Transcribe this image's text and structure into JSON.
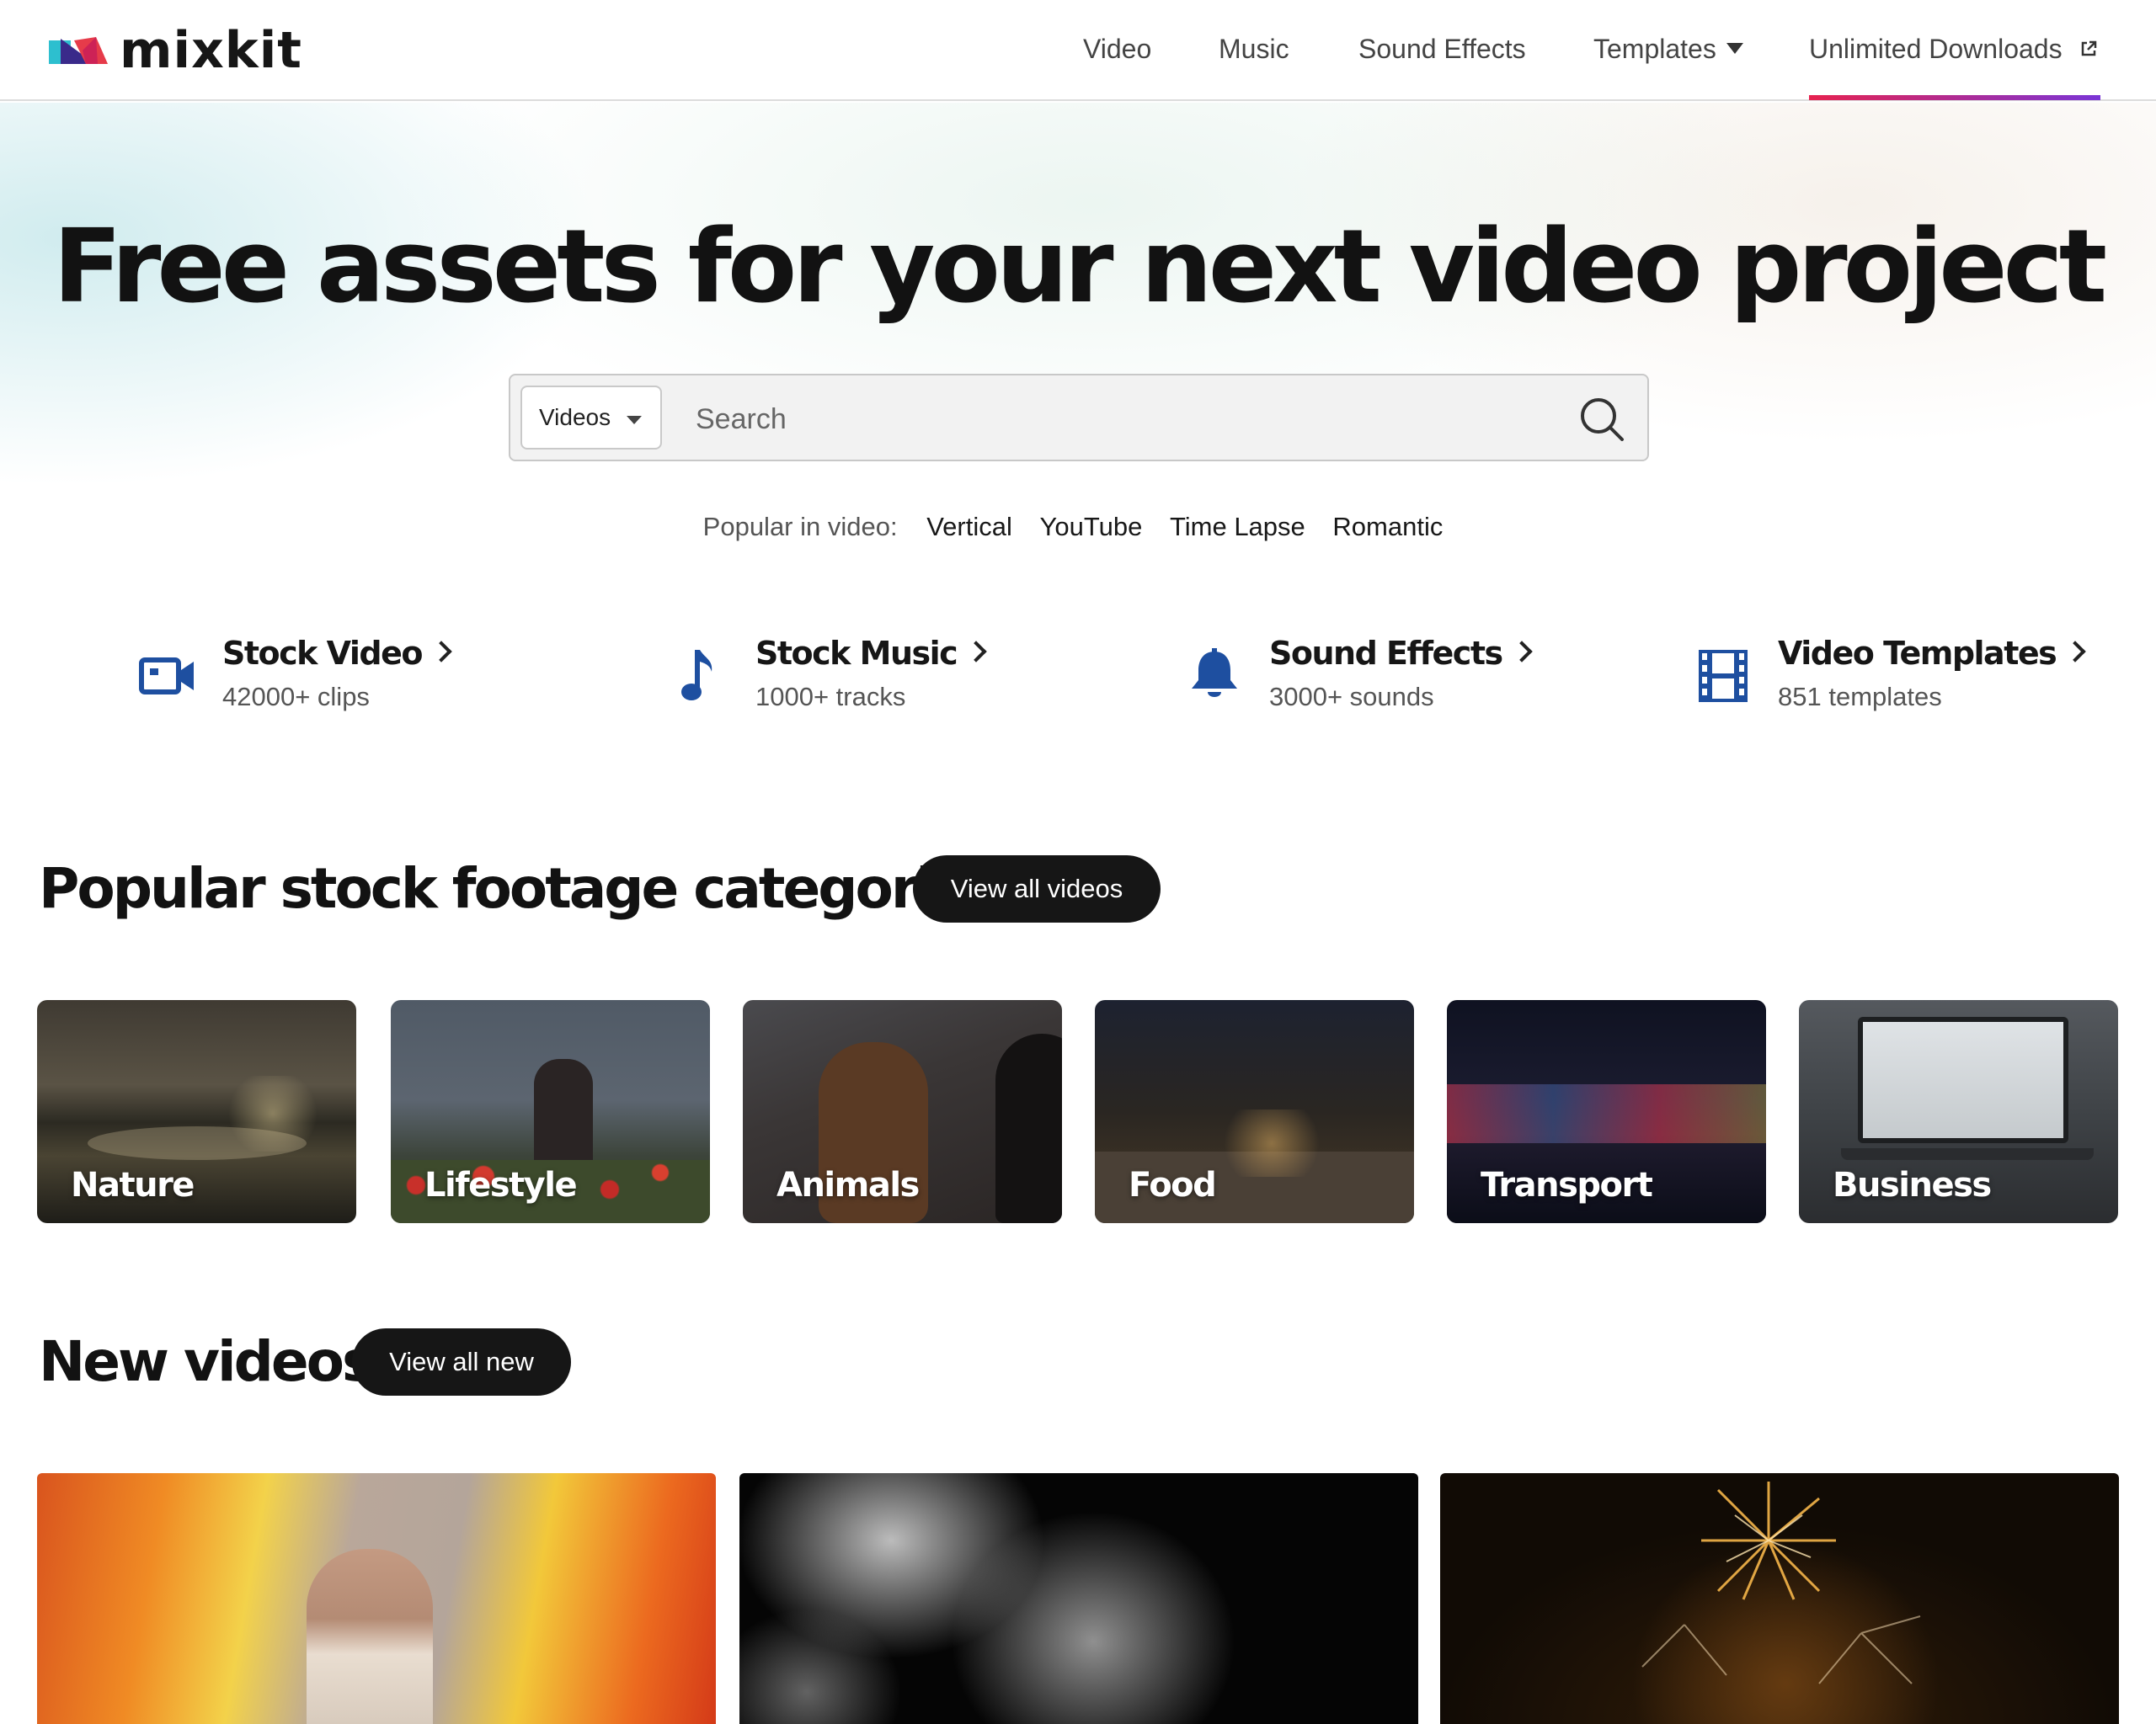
{
  "header": {
    "logo_text": "mixkit",
    "nav": {
      "video": "Video",
      "music": "Music",
      "sound_effects": "Sound Effects",
      "templates": "Templates",
      "unlimited_downloads": "Unlimited Downloads"
    }
  },
  "hero": {
    "title": "Free assets for your next video project",
    "search": {
      "category_selected": "Videos",
      "placeholder": "Search"
    },
    "popular": {
      "label": "Popular in video:",
      "links": [
        "Vertical",
        "YouTube",
        "Time Lapse",
        "Romantic"
      ]
    }
  },
  "features": [
    {
      "title": "Stock Video",
      "subtitle": "42000+ clips",
      "icon": "video-camera-icon"
    },
    {
      "title": "Stock Music",
      "subtitle": "1000+ tracks",
      "icon": "music-note-icon"
    },
    {
      "title": "Sound Effects",
      "subtitle": "3000+ sounds",
      "icon": "bell-icon"
    },
    {
      "title": "Video Templates",
      "subtitle": "851 templates",
      "icon": "film-strip-icon"
    }
  ],
  "categories_section": {
    "title": "Popular stock footage categories",
    "button": "View all videos",
    "items": [
      "Nature",
      "Lifestyle",
      "Animals",
      "Food",
      "Transport",
      "Business"
    ]
  },
  "new_videos_section": {
    "title": "New videos",
    "button": "View all new"
  },
  "colors": {
    "accent_blue": "#1e4fa0",
    "underline_start": "#e6224f",
    "underline_end": "#7a35d6",
    "pill_bg": "#161616"
  }
}
